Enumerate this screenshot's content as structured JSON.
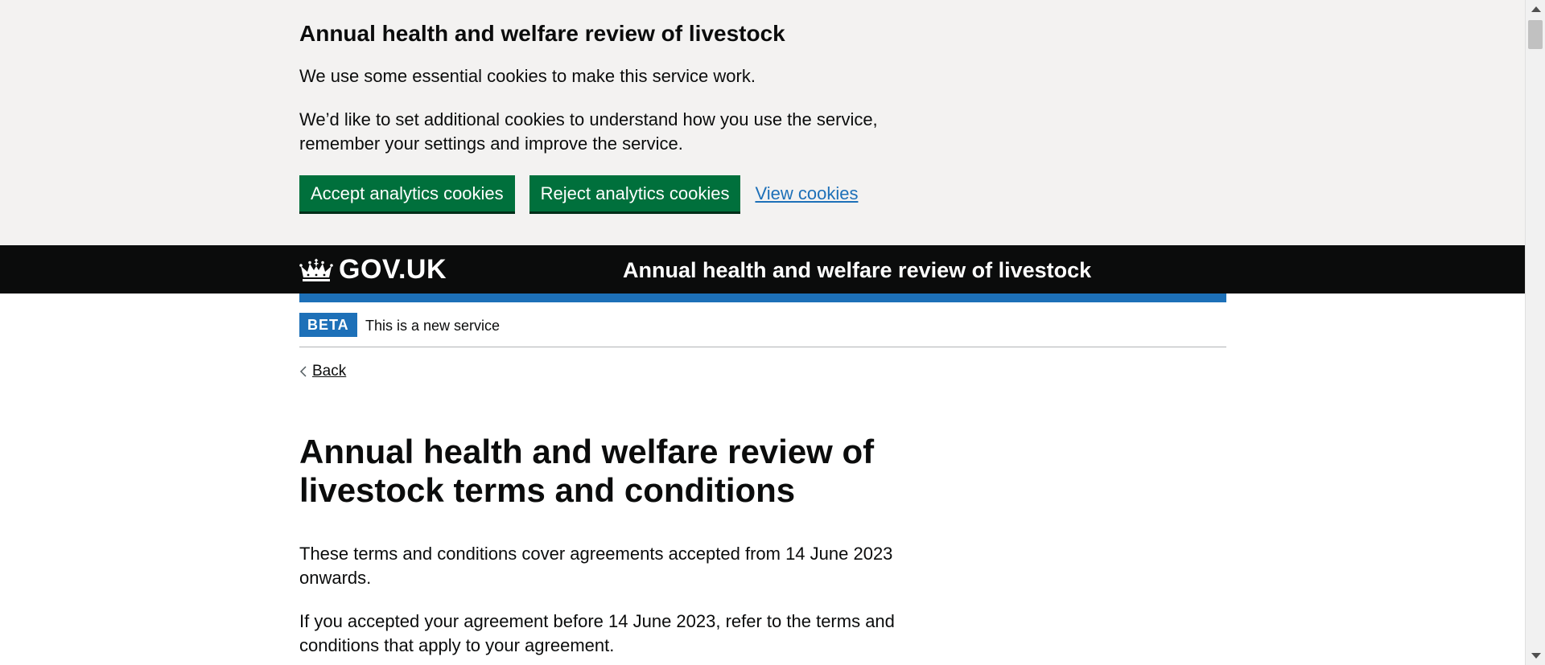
{
  "cookie_banner": {
    "heading": "Annual health and welfare review of livestock",
    "paragraph_1": "We use some essential cookies to make this service work.",
    "paragraph_2": "We’d like to set additional cookies to understand how you use the service, remember your settings and improve the service.",
    "accept_label": "Accept analytics cookies",
    "reject_label": "Reject analytics cookies",
    "view_label": "View cookies"
  },
  "header": {
    "logo_text": "GOV.UK",
    "logo_icon": "crown-icon",
    "service_name": "Annual health and welfare review of livestock"
  },
  "phase_banner": {
    "tag": "BETA",
    "text": "This is a new service"
  },
  "back_link": {
    "label": "Back",
    "icon": "chevron-left-icon"
  },
  "main": {
    "title": "Annual health and welfare review of livestock terms and conditions",
    "paragraph_1": "These terms and conditions cover agreements accepted from 14 June 2023 onwards.",
    "paragraph_2": "If you accepted your agreement before 14 June 2023, refer to the terms and conditions that apply to your agreement."
  },
  "colors": {
    "button_green": "#00703c",
    "header_black": "#0b0c0c",
    "brand_blue": "#1d70b8",
    "banner_grey": "#f3f2f1"
  }
}
